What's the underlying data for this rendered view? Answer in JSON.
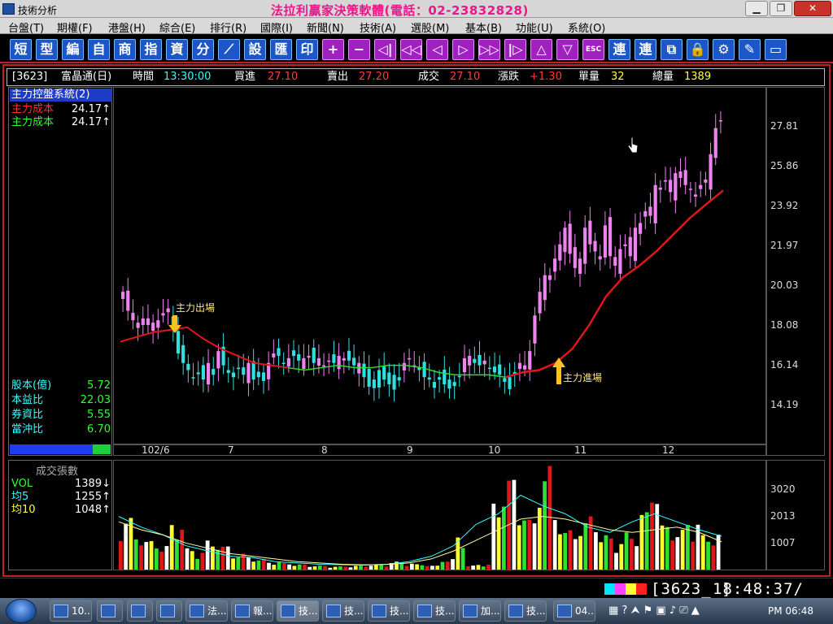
{
  "window": {
    "title": "技術分析",
    "brand": "法拉利贏家決策軟體(電話：02-23832828)"
  },
  "menu": [
    "台盤(T)",
    "期權(F)",
    "港盤(H)",
    "綜合(E)",
    "排行(R)",
    "國際(I)",
    "新聞(N)",
    "技術(A)",
    "選股(M)",
    "基本(B)",
    "功能(U)",
    "系統(O)"
  ],
  "toolbar": [
    "短",
    "型",
    "編",
    "自",
    "商",
    "指",
    "資",
    "分",
    "⟋",
    "設",
    "匯",
    "印",
    "+",
    "−",
    "◁|",
    "◁◁",
    "◁",
    "▷",
    "▷▷",
    "|▷",
    "△",
    "▽",
    "ESC",
    "連",
    "連",
    "⧉",
    "🔒",
    "⚙",
    "✎",
    "▭"
  ],
  "info": {
    "code": "[3623]",
    "name": "富晶通(日)",
    "time_label": "時間",
    "time": "13:30:00",
    "bid_label": "買進",
    "bid": "27.10",
    "ask_label": "賣出",
    "ask": "27.20",
    "deal_label": "成交",
    "deal": "27.10",
    "change_label": "漲跌",
    "change": "+1.30",
    "vol_label": "單量",
    "vol": "32",
    "total_label": "總量",
    "total": "1389"
  },
  "left_panel": {
    "title": "主力控盤系統(2)",
    "rows": [
      {
        "k": "主力成本",
        "v": "24.17↑",
        "color": "#ff3030"
      },
      {
        "k": "主力成本",
        "v": "24.17↑",
        "color": "#30ff30"
      }
    ],
    "stats": [
      {
        "k": "股本(億)",
        "v": "5.72"
      },
      {
        "k": "本益比",
        "v": "22.03"
      },
      {
        "k": "券資比",
        "v": "5.55"
      },
      {
        "k": "當沖比",
        "v": "6.70"
      }
    ]
  },
  "annotations": {
    "out": "主力出場",
    "in": "主力進場"
  },
  "y_ticks": [
    "27.81",
    "25.86",
    "23.92",
    "21.97",
    "20.03",
    "18.08",
    "16.14",
    "14.19"
  ],
  "x_ticks": [
    "102/6",
    "7",
    "8",
    "9",
    "10",
    "11",
    "12"
  ],
  "volume_panel": {
    "title": "成交張數",
    "rows": [
      {
        "k": "VOL",
        "v": "1389↓",
        "color": "#30ff30"
      },
      {
        "k": "均5",
        "v": "1255↑",
        "color": "#30ffff"
      },
      {
        "k": "均10",
        "v": "1048↑",
        "color": "#ffff30"
      }
    ],
    "y_ticks": [
      "3020",
      "2013",
      "1007"
    ]
  },
  "status": {
    "code": "[3623_ ]",
    "time": "18:48:37/"
  },
  "taskbar": {
    "items": [
      "10...",
      "",
      "",
      "",
      "法...",
      "報...",
      "技...",
      "技...",
      "技...",
      "技...",
      "加...",
      "技...",
      "04..."
    ],
    "clock": "PM 06:48"
  },
  "chart_data": {
    "type": "candlestick",
    "y_range": [
      13.5,
      28.5
    ],
    "x_period_labels": [
      "102/6",
      "7",
      "8",
      "9",
      "10",
      "11",
      "12"
    ],
    "candles_close_approx": [
      19.6,
      19.1,
      18.7,
      18.6,
      18.5,
      18.5,
      18.6,
      18.7,
      18.9,
      19.2,
      18.3,
      17.3,
      16.9,
      16.6,
      16.3,
      16.5,
      16.2,
      16.9,
      16.4,
      17.4,
      16.8,
      16.6,
      16.3,
      16.7,
      16.4,
      16.9,
      16.2,
      16.3,
      16.5,
      16.9,
      17.3,
      17.2,
      16.9,
      17.1,
      17.2,
      17.0,
      17.1,
      17.2,
      16.9,
      17.1,
      16.8,
      17.0,
      16.9,
      17.2,
      17.1,
      17.0,
      16.8,
      16.9,
      16.3,
      15.9,
      16.2,
      16.6,
      16.2,
      16.0,
      16.4,
      16.3,
      16.9,
      17.1,
      16.8,
      16.6,
      16.3,
      16.2,
      16.1,
      16.3,
      16.0,
      16.2,
      16.1,
      16.3,
      17.1,
      17.2,
      16.9,
      16.8,
      17.0,
      16.7,
      16.5,
      16.4,
      16.1,
      16.3,
      16.4,
      16.9,
      16.8,
      17.4,
      18.9,
      19.9,
      20.6,
      20.4,
      21.3,
      21.9,
      22.6,
      21.5,
      20.9,
      21.3,
      22.6,
      21.9,
      21.6,
      21.4,
      22.7,
      21.4,
      21.0,
      21.7,
      21.9,
      21.4,
      22.6,
      22.8,
      23.3,
      23.1,
      24.4,
      24.2,
      24.6,
      24.1,
      24.9,
      24.7,
      24.4,
      24.2,
      24.0,
      24.4,
      24.5,
      25.7,
      26.8,
      27.1
    ],
    "cost_line_approx": [
      17.8,
      18.0,
      18.2,
      18.3,
      18.4,
      17.9,
      17.5,
      17.2,
      16.9,
      16.8,
      16.7,
      16.6,
      16.7,
      16.8,
      16.7,
      16.7,
      16.8,
      16.8,
      16.7,
      16.5,
      16.4,
      16.4,
      16.4,
      16.3,
      16.5,
      16.6,
      16.9,
      17.5,
      18.5,
      19.7,
      20.5,
      21.0,
      21.6,
      22.3,
      23.0,
      23.6,
      24.17
    ],
    "volume_approx_lots": [
      1950,
      1400,
      1100,
      900,
      1800,
      800,
      700,
      1100,
      900,
      600,
      500,
      400,
      300,
      250,
      200,
      150,
      150,
      120,
      130,
      150,
      200,
      180,
      300,
      250,
      200,
      150,
      400,
      1300,
      150,
      200,
      2500,
      3500,
      2400,
      1900,
      3900,
      2200,
      1500,
      1800,
      2100,
      1300,
      1100,
      1400,
      2200,
      3400,
      1700,
      1500,
      1900,
      1300,
      1389
    ],
    "volume_ma5_approx": [
      2000,
      1600,
      1300,
      900,
      700,
      500,
      450,
      300,
      250,
      200,
      180,
      170,
      200,
      300,
      500,
      900,
      1700,
      2100,
      2800,
      2400,
      2100,
      1600,
      1400,
      1800,
      2100,
      1800,
      1500,
      1255
    ],
    "volume_ma10_approx": [
      1800,
      1500,
      1300,
      1000,
      800,
      600,
      500,
      400,
      300,
      250,
      200,
      180,
      190,
      250,
      400,
      700,
      1100,
      1500,
      1900,
      2000,
      1900,
      1700,
      1500,
      1400,
      1500,
      1600,
      1400,
      1048
    ]
  }
}
